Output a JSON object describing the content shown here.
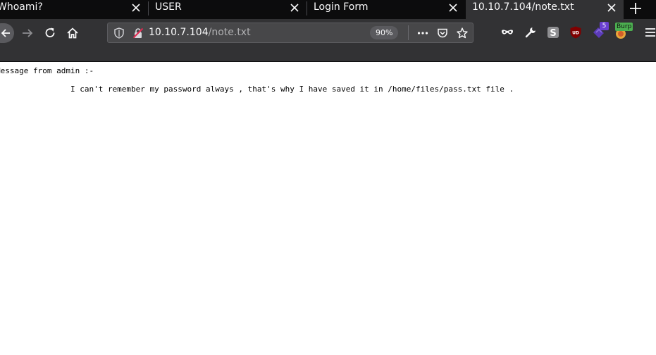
{
  "tabs": [
    {
      "title": "Whoami?"
    },
    {
      "title": "USER"
    },
    {
      "title": "Login Form"
    },
    {
      "title": "10.10.7.104/note.txt"
    }
  ],
  "navigation": {
    "url_host": "10.10.7.104",
    "url_path": "/note.txt",
    "zoom": "90%"
  },
  "extensions": {
    "ublock_label": "UD",
    "badge_count": "5",
    "burp_label": "Burp"
  },
  "page": {
    "lines": [
      "Message from admin :-",
      "",
      "                I can't remember my password always , that's why I have saved it in /home/files/pass.txt file ."
    ]
  }
}
